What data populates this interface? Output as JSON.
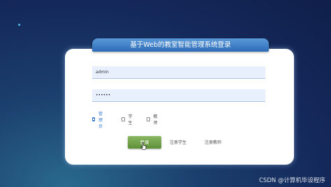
{
  "title": "基于Web的教室智能管理系统登录",
  "form": {
    "username_value": "admin",
    "password_value": "••••••"
  },
  "roles": [
    {
      "label": "管理员",
      "checked": true
    },
    {
      "label": "学生",
      "checked": false
    },
    {
      "label": "教师",
      "checked": false
    }
  ],
  "buttons": {
    "login": "登录",
    "register_student": "注册学生",
    "register_teacher": "注册教师"
  },
  "watermark": "CSDN @计算机毕设程序",
  "colors": {
    "accent": "#3f7fd0",
    "login_button": "#6e9e48",
    "title_bar": "#3a7cc6"
  }
}
